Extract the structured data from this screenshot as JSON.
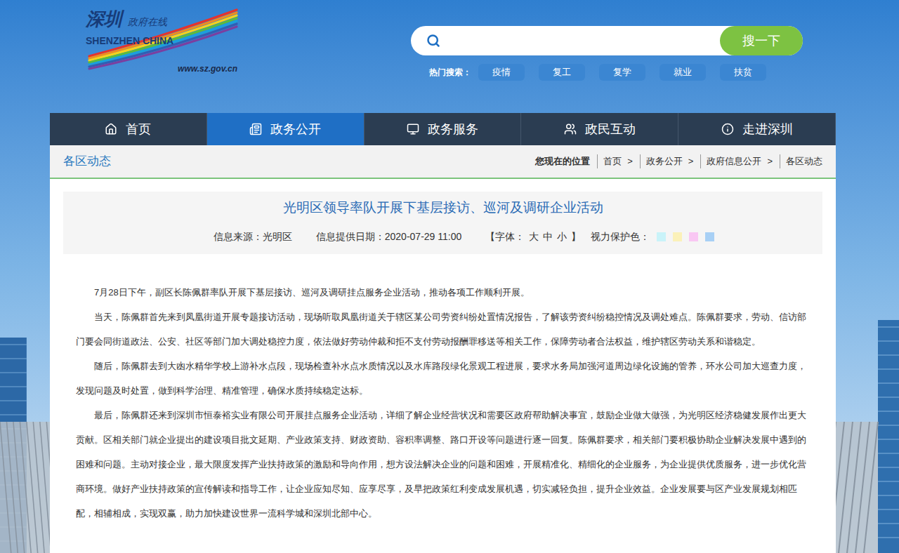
{
  "site": {
    "logo_title": "深圳",
    "logo_subtitle": "政府在线",
    "logo_en": "SHENZHEN CHINA",
    "logo_url": "www.sz.gov.cn"
  },
  "search": {
    "button": "搜一下"
  },
  "hot_search": {
    "label": "热门搜索：",
    "items": [
      "疫情",
      "复工",
      "复学",
      "就业",
      "扶贫"
    ]
  },
  "nav": [
    {
      "label": "首页",
      "selected": false
    },
    {
      "label": "政务公开",
      "selected": true
    },
    {
      "label": "政务服务",
      "selected": false
    },
    {
      "label": "政民互动",
      "selected": false
    },
    {
      "label": "走进深圳",
      "selected": false
    }
  ],
  "section_title": "各区动态",
  "breadcrumb": {
    "label": "您现在的位置",
    "separator": ">",
    "items": [
      "首页",
      "政务公开",
      "政府信息公开",
      "各区动态"
    ]
  },
  "article": {
    "title": "光明区领导率队开展下基层接访、巡河及调研企业活动",
    "source": "信息来源：光明区",
    "date": "信息提供日期：2020-07-29 11:00",
    "font_size": {
      "label": "【字体：",
      "options": [
        "大",
        "中",
        "小"
      ],
      "close": "】"
    },
    "eye_care": {
      "label": "视力保护色：",
      "colors": [
        {
          "color": "#c9f3f9"
        },
        {
          "color": "#fbf1b9"
        },
        {
          "color": "#f9c7f3"
        },
        {
          "color": "#a8d0f5"
        }
      ]
    },
    "paragraphs": [
      "7月28日下午，副区长陈佩群率队开展下基层接访、巡河及调研挂点服务企业活动，推动各项工作顺利开展。",
      "当天，陈佩群首先来到凤凰街道开展专题接访活动，现场听取凤凰街道关于辖区某公司劳资纠纷处置情况报告，了解该劳资纠纷稳控情况及调处难点。陈佩群要求，劳动、信访部门要会同街道政法、公安、社区等部门加大调处稳控力度，依法做好劳动仲裁和拒不支付劳动报酬罪移送等相关工作，保障劳动者合法权益，维护辖区劳动关系和谐稳定。",
      "随后，陈佩群去到大凼水精华学校上游补水点段，现场检查补水点水质情况以及水库路段绿化景观工程进展，要求水务局加强河道周边绿化设施的管养，环水公司加大巡查力度，发现问题及时处置，做到科学治理、精准管理，确保水质持续稳定达标。",
      "最后，陈佩群还来到深圳市恒泰裕实业有限公司开展挂点服务企业活动，详细了解企业经营状况和需要区政府帮助解决事宜，鼓励企业做大做强，为光明区经济稳健发展作出更大贡献。区相关部门就企业提出的建设项目批文延期、产业政策支持、财政资助、容积率调整、路口开设等问题进行逐一回复。陈佩群要求，相关部门要积极协助企业解决发展中遇到的困难和问题。主动对接企业，最大限度发挥产业扶持政策的激励和导向作用，想方设法解决企业的问题和困难，开展精准化、精细化的企业服务，为企业提供优质服务，进一步优化营商环境。做好产业扶持政策的宣传解读和指导工作，让企业应知尽知、应享尽享，及早把政策红利变成发展机遇，切实减轻负担，提升企业效益。企业发展要与区产业发展规划相匹配，相辅相成，实现双赢，助力加快建设世界一流科学城和深圳北部中心。"
    ]
  }
}
